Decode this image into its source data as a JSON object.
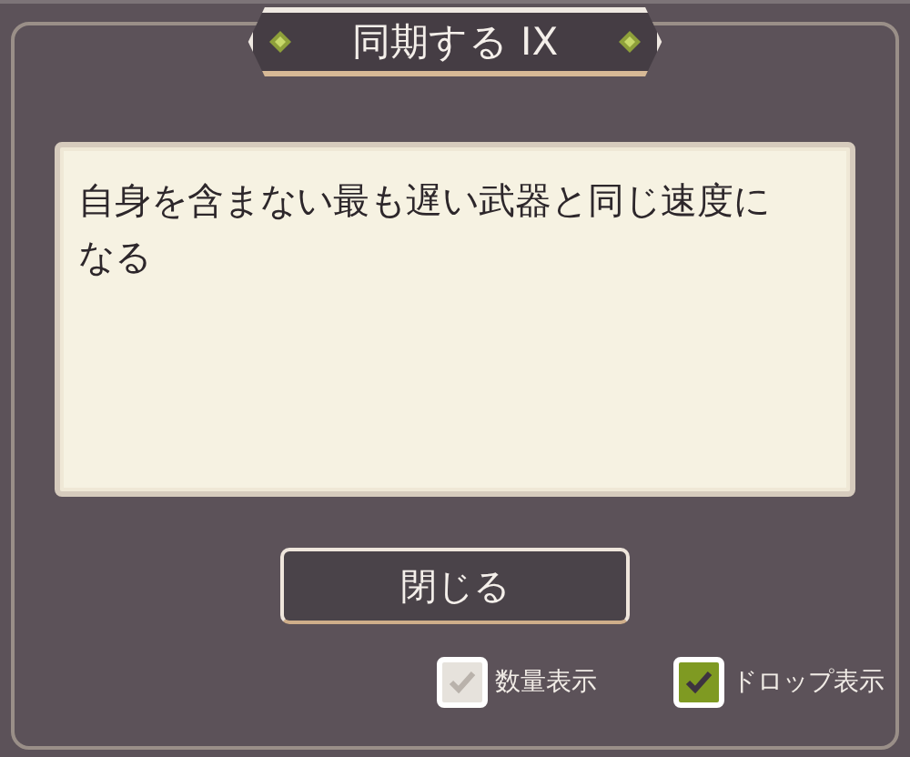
{
  "dialog": {
    "title": "同期する IX",
    "description": "自身を含まない最も遅い武器と同じ速度になる",
    "close_button": "閉じる"
  },
  "options": [
    {
      "label": "数量表示",
      "checked": true,
      "disabled": true
    },
    {
      "label": "ドロップ表示",
      "checked": true,
      "disabled": false
    }
  ]
}
